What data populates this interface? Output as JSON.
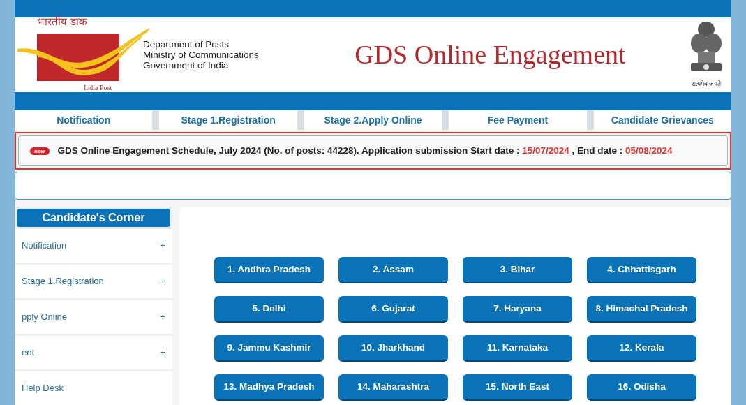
{
  "header": {
    "logo_hindi": "भारतीय डाक",
    "logo_caption": "India Post",
    "department_lines": [
      "Department of Posts",
      "Ministry of Communications",
      "Government of India"
    ],
    "title": "GDS Online Engagement",
    "emblem_motto": "सत्यमेव जयते"
  },
  "nav": [
    "Notification",
    "Stage 1.Registration",
    "Stage 2.Apply Online",
    "Fee Payment",
    "Candidate Grievances"
  ],
  "notice": {
    "badge": "new",
    "text": "GDS Online Engagement Schedule, July 2024 (No. of posts: 44228). Application submission Start date : ",
    "start_date": "15/07/2024",
    "middle": " , End date : ",
    "end_date": "05/08/2024"
  },
  "sidebar": {
    "title": "Candidate's Corner",
    "items": [
      {
        "label": "Notification",
        "toggle": "+"
      },
      {
        "label": "Stage 1.Registration",
        "toggle": "+"
      },
      {
        "label": "pply Online",
        "toggle": "+"
      },
      {
        "label": "ent",
        "toggle": "+"
      },
      {
        "label": "Help Desk"
      }
    ]
  },
  "circles": [
    "1. Andhra Pradesh",
    "2. Assam",
    "3. Bihar",
    "4. Chhattisgarh",
    "5. Delhi",
    "6. Gujarat",
    "7. Haryana",
    "8. Himachal Pradesh",
    "9. Jammu Kashmir",
    "10. Jharkhand",
    "11. Karnataka",
    "12. Kerala",
    "13. Madhya Pradesh",
    "14. Maharashtra",
    "15. North East",
    "16. Odisha"
  ]
}
